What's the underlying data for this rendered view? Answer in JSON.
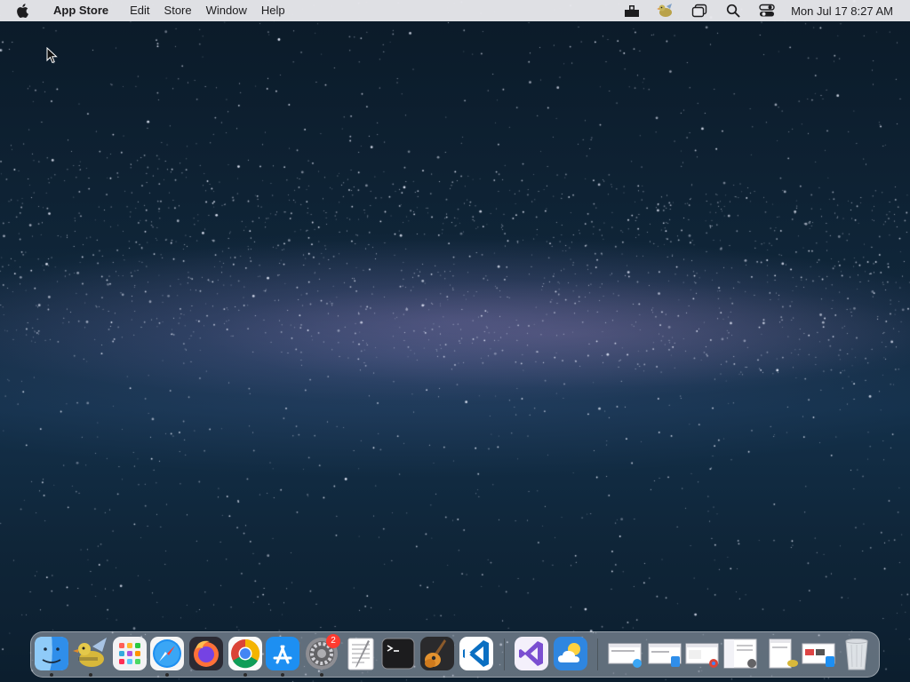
{
  "menubar": {
    "app_name": "App Store",
    "menus": [
      "Edit",
      "Store",
      "Window",
      "Help"
    ],
    "status_icons": [
      "stats-icon",
      "cyberduck-icon",
      "window-icon",
      "search-icon",
      "control-center-icon"
    ],
    "clock": "Mon Jul 17  8:27 AM"
  },
  "dock": {
    "apps": [
      {
        "name": "Finder",
        "running": true
      },
      {
        "name": "Cyberduck",
        "running": true
      },
      {
        "name": "Launchpad",
        "running": false
      },
      {
        "name": "Safari",
        "running": true
      },
      {
        "name": "Firefox",
        "running": false
      },
      {
        "name": "Google Chrome",
        "running": true
      },
      {
        "name": "App Store",
        "running": true
      },
      {
        "name": "System Settings",
        "running": true,
        "badge": "2"
      },
      {
        "name": "TextEdit",
        "running": false
      },
      {
        "name": "Terminal",
        "running": false
      },
      {
        "name": "GarageBand",
        "running": false
      },
      {
        "name": "Visual Studio Code",
        "running": false
      }
    ],
    "recent_apps": [
      "Visual Studio",
      "Weather"
    ],
    "minimized_windows": [
      "Safari window",
      "Finder window",
      "Chrome window",
      "System Settings window",
      "Cyberduck window",
      "App Store window"
    ],
    "trash": "Trash"
  },
  "colors": {
    "menubar_bg": "#e8e8ec",
    "badge": "#ff3b30"
  }
}
